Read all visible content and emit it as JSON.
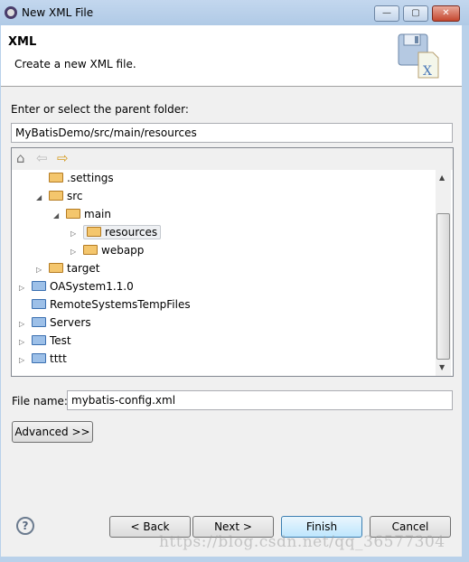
{
  "window": {
    "title": "New XML File",
    "minimize": "—",
    "maximize": "▢",
    "close": "✕"
  },
  "header": {
    "title": "XML",
    "description": "Create a new XML file.",
    "image_icon": "xml-file-wizard-icon"
  },
  "parent_folder": {
    "label": "Enter or select the parent folder:",
    "value": "MyBatisDemo/src/main/resources"
  },
  "tree_toolbar": {
    "home": "⌂",
    "back": "⇦",
    "forward": "⇨"
  },
  "tree": [
    {
      "label": ".settings",
      "depth": 2,
      "twisty": "",
      "type": "folder"
    },
    {
      "label": "src",
      "depth": 2,
      "twisty": "◢",
      "type": "folder"
    },
    {
      "label": "main",
      "depth": 3,
      "twisty": "◢",
      "type": "folder"
    },
    {
      "label": "resources",
      "depth": 4,
      "twisty": "▷",
      "type": "folder",
      "selected": true
    },
    {
      "label": "webapp",
      "depth": 4,
      "twisty": "▷",
      "type": "folder"
    },
    {
      "label": "target",
      "depth": 2,
      "twisty": "▷",
      "type": "folder"
    },
    {
      "label": "OASystem1.1.0",
      "depth": 1,
      "twisty": "▷",
      "type": "project"
    },
    {
      "label": "RemoteSystemsTempFiles",
      "depth": 1,
      "twisty": "",
      "type": "project"
    },
    {
      "label": "Servers",
      "depth": 1,
      "twisty": "▷",
      "type": "project"
    },
    {
      "label": "Test",
      "depth": 1,
      "twisty": "▷",
      "type": "project"
    },
    {
      "label": "tttt",
      "depth": 1,
      "twisty": "▷",
      "type": "project"
    }
  ],
  "file_name": {
    "label": "File name:",
    "value": "mybatis-config.xml"
  },
  "buttons": {
    "advanced": "Advanced >>",
    "back": "< Back",
    "next": "Next >",
    "finish": "Finish",
    "cancel": "Cancel",
    "help": "?"
  },
  "watermark": "https://blog.csdn.net/qq_36577304"
}
